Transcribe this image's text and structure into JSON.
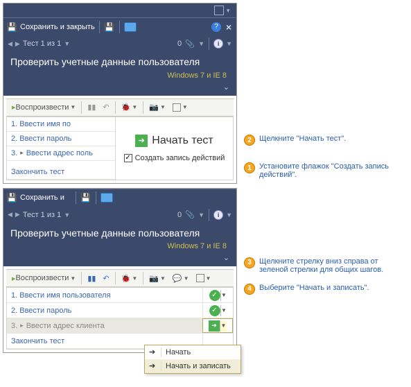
{
  "pane1": {
    "titlebar": {
      "save_close": "Сохранить и закрыть"
    },
    "nav": {
      "counter": "Тест 1 из 1",
      "count": "0"
    },
    "header": "Проверить учетные данные пользователя",
    "subheader": "Windows 7 и IE 8",
    "toolbar": {
      "play_label": "Воспроизвести"
    },
    "steps": {
      "s1": "1. Ввести имя по",
      "s2": "2. Ввести пароль",
      "s3_prefix": "3.",
      "s3": "Ввести адрес поль",
      "end": "Закончить тест"
    },
    "start": {
      "label": "Начать тест",
      "checkbox_label": "Создать запись действий"
    }
  },
  "pane2": {
    "titlebar": {
      "save_close": "Сохранить и"
    },
    "nav": {
      "counter": "Тест 1 из 1",
      "count": "0"
    },
    "header": "Проверить учетные данные пользователя",
    "subheader": "Windows 7 и IE 8",
    "toolbar": {
      "play_label": "Воспроизвести"
    },
    "steps": {
      "s1": "1. Ввести имя пользователя",
      "s2": "2. Ввести пароль",
      "s3_prefix": "3.",
      "s3": "Ввести адрес клиента",
      "end": "Закончить тест"
    },
    "dropdown": {
      "start": "Начать",
      "start_record": "Начать и записать"
    }
  },
  "callouts": {
    "c1": "Установите флажок \"Создать запись действий\".",
    "c2": "Щелкните \"Начать тест\".",
    "c3": "Щелкните стрелку вниз справа от зеленой стрелки для общих шагов.",
    "c4": "Выберите \"Начать и записать\".",
    "n1": "1",
    "n2": "2",
    "n3": "3",
    "n4": "4"
  }
}
